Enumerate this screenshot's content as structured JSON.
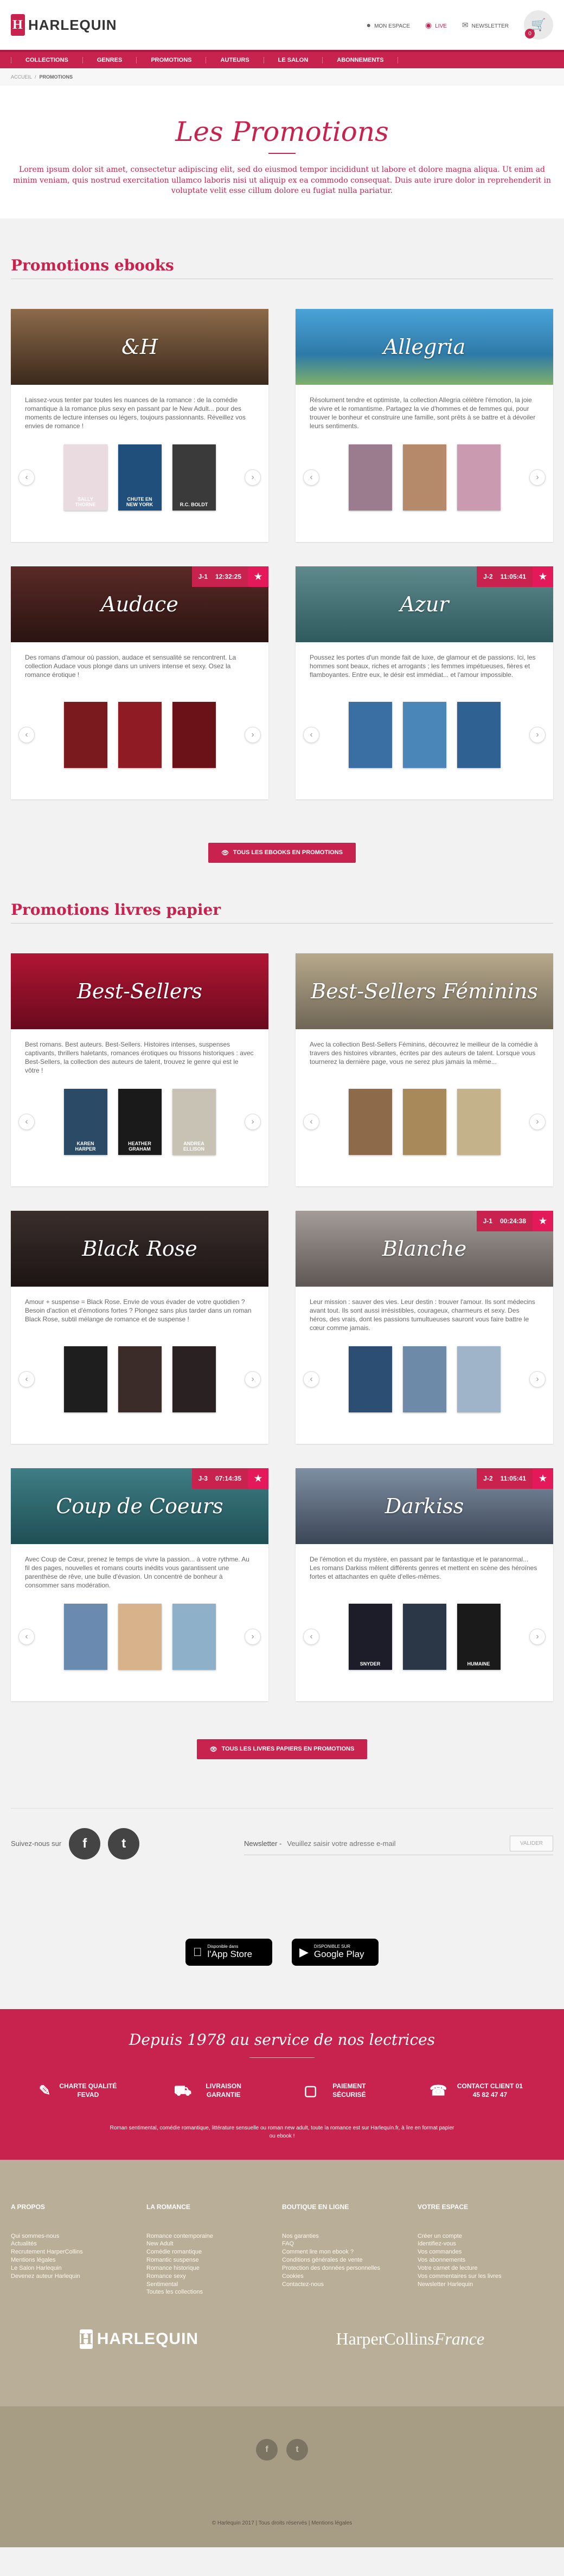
{
  "header": {
    "logo_letter": "H",
    "logo_text": "HARLEQUIN",
    "links": {
      "account": "MON ESPACE",
      "live": "LIVE",
      "newsletter": "NEWSLETTER"
    },
    "cart_count": "0"
  },
  "nav": [
    "COLLECTIONS",
    "GENRES",
    "PROMOTIONS",
    "AUTEURS",
    "LE SALON",
    "ABONNEMENTS"
  ],
  "breadcrumb": {
    "home": "ACCUEIL",
    "sep": "/",
    "current": "PROMOTIONS"
  },
  "hero": {
    "title": "Les Promotions",
    "text": "Lorem ipsum dolor sit amet, consectetur adipiscing elit, sed do eiusmod tempor incididunt ut labore et dolore magna aliqua. Ut enim ad minim veniam, quis nostrud exercitation ullamco laboris nisi ut aliquip ex ea commodo consequat. Duis aute irure dolor in reprehenderit in voluptate velit esse cillum dolore eu fugiat nulla pariatur."
  },
  "ebooks": {
    "heading": "Promotions ebooks",
    "cta": "TOUS LES EBOOKS EN PROMOTIONS",
    "cards": [
      {
        "title": "&H",
        "countdown": null,
        "bg": "linear-gradient(180deg,#8c6a4a,#3b2a1c)",
        "desc": "Laissez-vous tenter par toutes les nuances de la romance : de la comédie romantique à la romance plus sexy en passant par le New Adult... pour des moments de lecture intenses ou légers, toujours passionnants. Réveillez vos envies de romance !",
        "covers": [
          {
            "t": "SALLY THORNE",
            "c": "#e9dbe0"
          },
          {
            "t": "CHUTE EN NEW YORK",
            "c": "#1f4f7a"
          },
          {
            "t": "R.C. BOLDT",
            "c": "#3a3a3a"
          }
        ]
      },
      {
        "title": "Allegria",
        "countdown": null,
        "bg": "linear-gradient(180deg,#4aa3d8,#2e7aa8 60%,#7fb06a)",
        "desc": "Résolument tendre et optimiste, la collection Allegria célèbre l'émotion, la joie de vivre et le romantisme. Partagez la vie d'hommes et de femmes qui, pour trouver le bonheur et construire une famille, sont prêts à se battre et à dévoiler leurs sentiments.",
        "covers": [
          {
            "t": "",
            "c": "#9b7c8e"
          },
          {
            "t": "",
            "c": "#b58a6a"
          },
          {
            "t": "",
            "c": "#c99ab0"
          }
        ]
      },
      {
        "title": "Audace",
        "countdown": {
          "day": "J-1",
          "time": "12:32:25"
        },
        "bg": "linear-gradient(180deg,#5a2a26,#2a1412)",
        "desc": "Des romans d'amour où passion, audace et sensualité se rencontrent. La collection Audace vous plonge dans un univers intense et sexy. Osez la romance érotique !",
        "covers": [
          {
            "t": "",
            "c": "#7a1a1e"
          },
          {
            "t": "",
            "c": "#8f1c25"
          },
          {
            "t": "",
            "c": "#6a1218"
          }
        ]
      },
      {
        "title": "Azur",
        "countdown": {
          "day": "J-2",
          "time": "11:05:41"
        },
        "bg": "linear-gradient(180deg,#5f8a8c,#2f5a5e)",
        "desc": "Poussez les portes d'un monde fait de luxe, de glamour et de passions. Ici, les hommes sont beaux, riches et arrogants ; les femmes impétueuses, fières et flamboyantes. Entre eux, le désir est immédiat... et l'amour impossible.",
        "covers": [
          {
            "t": "",
            "c": "#3a6fa3"
          },
          {
            "t": "",
            "c": "#4a86b8"
          },
          {
            "t": "",
            "c": "#2f6292"
          }
        ]
      }
    ]
  },
  "papier": {
    "heading": "Promotions livres papier",
    "cta": "TOUS LES LIVRES PAPIERS EN PROMOTIONS",
    "cards": [
      {
        "title": "Best-Sellers",
        "countdown": null,
        "bg": "linear-gradient(180deg,#b01633,#6a0a1d)",
        "desc": "Best romans. Best auteurs. Best-Sellers. Histoires intenses, suspenses captivants, thrillers haletants, romances érotiques ou frissons historiques : avec Best-Sellers, la collection des auteurs de talent, trouvez le genre qui est le vôtre !",
        "covers": [
          {
            "t": "KAREN HARPER",
            "c": "#2b4a66"
          },
          {
            "t": "HEATHER GRAHAM",
            "c": "#1a1a1a"
          },
          {
            "t": "ANDREA ELLISON",
            "c": "#c7c2b4"
          }
        ]
      },
      {
        "title": "Best-Sellers Féminins",
        "countdown": null,
        "bg": "linear-gradient(180deg,#b7a98b,#6f6656)",
        "desc": "Avec la collection Best-Sellers Féminins, découvrez le meilleur de la comédie à travers des histoires vibrantes, écrites par des auteurs de talent. Lorsque vous tournerez la dernière page, vous ne serez plus jamais la même...",
        "covers": [
          {
            "t": "",
            "c": "#8c6a4a"
          },
          {
            "t": "",
            "c": "#a88a5a"
          },
          {
            "t": "",
            "c": "#c4b28a"
          }
        ]
      },
      {
        "title": "Black Rose",
        "countdown": null,
        "bg": "linear-gradient(180deg,#3a2e2c,#1c1514)",
        "desc": "Amour + suspense = Black Rose. Envie de vous évader de votre quotidien ? Besoin d'action et d'émotions fortes ? Plongez sans plus tarder dans un roman Black Rose, subtil mélange de romance et de suspense !",
        "covers": [
          {
            "t": "",
            "c": "#1e1e1e"
          },
          {
            "t": "",
            "c": "#3b2c2a"
          },
          {
            "t": "",
            "c": "#2a2222"
          }
        ]
      },
      {
        "title": "Blanche",
        "countdown": {
          "day": "J-1",
          "time": "00:24:38"
        },
        "bg": "linear-gradient(180deg,#a39c98,#5e5754)",
        "desc": "Leur mission : sauver des vies. Leur destin : trouver l'amour. Ils sont médecins avant tout. Ils sont aussi irrésistibles, courageux, charmeurs et sexy. Des héros, des vrais, dont les passions tumultueuses sauront vous faire battre le cœur comme jamais.",
        "covers": [
          {
            "t": "",
            "c": "#2c4e73"
          },
          {
            "t": "",
            "c": "#6d8aa8"
          },
          {
            "t": "",
            "c": "#9fb4c8"
          }
        ]
      },
      {
        "title": "Coup de Coeurs",
        "countdown": {
          "day": "J-3",
          "time": "07:14:35"
        },
        "bg": "linear-gradient(180deg,#3e7e84,#1f4f55)",
        "desc": "Avec Coup de Cœur, prenez le temps de vivre la passion... à votre rythme. Au fil des pages, nouvelles et romans courts inédits vous garantissent une parenthèse de rêve, une bulle d'évasion. Un concentré de bonheur à consommer sans modération.",
        "covers": [
          {
            "t": "",
            "c": "#6a8ab0"
          },
          {
            "t": "",
            "c": "#d7b28a"
          },
          {
            "t": "",
            "c": "#8fb0c9"
          }
        ]
      },
      {
        "title": "Darkiss",
        "countdown": {
          "day": "J-2",
          "time": "11:05:41"
        },
        "bg": "linear-gradient(180deg,#7f8fa3,#3b4656)",
        "desc": "De l'émotion et du mystère, en passant par le fantastique et le paranormal... Les romans Darkiss mêlent différents genres et mettent en scène des héroïnes fortes et attachantes en quête d'elles-mêmes.",
        "covers": [
          {
            "t": "SNYDER",
            "c": "#1d1d2a"
          },
          {
            "t": "",
            "c": "#2b3646"
          },
          {
            "t": "HUMAINE",
            "c": "#1a1a1a"
          }
        ]
      }
    ]
  },
  "social": {
    "follow": "Suivez-nous sur",
    "newsletter_label": "Newsletter -",
    "newsletter_placeholder": "Veuillez saisir votre adresse e-mail",
    "submit": "VALIDER"
  },
  "apps": {
    "apple": {
      "small": "Disponible dans",
      "big": "l'App Store"
    },
    "google": {
      "small": "DISPONIBLE SUR",
      "big": "Google Play"
    }
  },
  "footer_red": {
    "title": "Depuis 1978 au service de nos lectrices",
    "features": [
      "CHARTE QUALITÉ FEVAD",
      "LIVRAISON GARANTIE",
      "PAIEMENT SÉCURISÉ",
      "CONTACT CLIENT 01 45 82 47 47"
    ],
    "legal": "Roman sentimental, comédie romantique, littérature sensuelle ou roman new adult, toute la romance est sur Harlequin.fr, à lire en format papier ou ebook !"
  },
  "footer_cols": [
    {
      "title": "A PROPOS",
      "links": [
        "Qui sommes-nous",
        "Actualités",
        "Recrutement HarperCollins",
        "Mentions légales",
        "Le Salon Harlequin",
        "Devenez auteur Harlequin"
      ]
    },
    {
      "title": "LA ROMANCE",
      "links": [
        "Romance contemporaine",
        "New Adult",
        "Comédie romantique",
        "Romantic suspense",
        "Romance historique",
        "Romance sexy",
        "Sentimental",
        "Toutes les collections"
      ]
    },
    {
      "title": "BOUTIQUE EN LIGNE",
      "links": [
        "Nos garanties",
        "FAQ",
        "Comment lire mon ebook ?",
        "Conditions générales de vente",
        "Protection des données personnelles",
        "Cookies",
        "Contactez-nous"
      ]
    },
    {
      "title": "VOTRE ESPACE",
      "links": [
        "Créer un compte",
        "Identifiez-vous",
        "Vos commandes",
        "Vos abonnements",
        "Votre carnet de lecture",
        "Vos commentaires sur les livres",
        "Newsletter Harlequin"
      ]
    }
  ],
  "brands": {
    "harlequin": "HARLEQUIN",
    "harlequin_mark": "H",
    "hc_main": "HarperCollins",
    "hc_country": "France"
  },
  "copyright": "© Harlequin 2017 | Tous droits réservés | Mentions légales",
  "colors": {
    "brand": "#c8234f",
    "beige": "#b9ae97"
  }
}
